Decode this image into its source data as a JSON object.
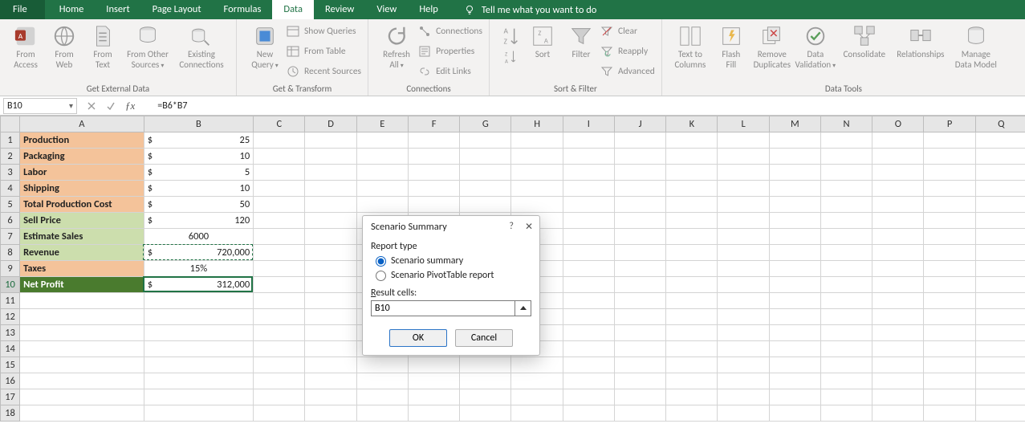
{
  "tabs": {
    "file": "File",
    "home": "Home",
    "insert": "Insert",
    "page_layout": "Page Layout",
    "formulas": "Formulas",
    "data": "Data",
    "review": "Review",
    "view": "View",
    "help": "Help",
    "tell": "Tell me what you want to do"
  },
  "ribbon": {
    "ext_data": {
      "label": "Get External Data",
      "from_access": "From\nAccess",
      "from_web": "From\nWeb",
      "from_text": "From\nText",
      "from_other": "From Other\nSources",
      "existing": "Existing\nConnections"
    },
    "get_transform": {
      "label": "Get & Transform",
      "new_query": "New\nQuery",
      "show_queries": "Show Queries",
      "from_table": "From Table",
      "recent_sources": "Recent Sources"
    },
    "connections": {
      "label": "Connections",
      "refresh_all": "Refresh\nAll",
      "connections": "Connections",
      "properties": "Properties",
      "edit_links": "Edit Links"
    },
    "sort_filter": {
      "label": "Sort & Filter",
      "sort": "Sort",
      "filter": "Filter",
      "clear": "Clear",
      "reapply": "Reapply",
      "advanced": "Advanced"
    },
    "data_tools": {
      "label": "Data Tools",
      "text_to_columns": "Text to\nColumns",
      "flash_fill": "Flash\nFill",
      "remove_dup": "Remove\nDuplicates",
      "data_validation": "Data\nValidation",
      "consolidate": "Consolidate",
      "relationships": "Relationships",
      "manage_model": "Manage\nData Model"
    }
  },
  "formula_bar": {
    "name": "B10",
    "formula": "=B6*B7"
  },
  "columns": [
    "A",
    "B",
    "C",
    "D",
    "E",
    "F",
    "G",
    "H",
    "I",
    "J",
    "K",
    "L",
    "M",
    "N",
    "O",
    "P",
    "Q"
  ],
  "rows": [
    {
      "n": 1,
      "a": "Production",
      "b_cur": "$",
      "b_val": "25",
      "a_cls": "orange"
    },
    {
      "n": 2,
      "a": "Packaging",
      "b_cur": "$",
      "b_val": "10",
      "a_cls": "orange"
    },
    {
      "n": 3,
      "a": "Labor",
      "b_cur": "$",
      "b_val": "5",
      "a_cls": "orange"
    },
    {
      "n": 4,
      "a": "Shipping",
      "b_cur": "$",
      "b_val": "10",
      "a_cls": "orange"
    },
    {
      "n": 5,
      "a": "Total Production Cost",
      "b_cur": "$",
      "b_val": "50",
      "a_cls": "orange"
    },
    {
      "n": 6,
      "a": "Sell Price",
      "b_cur": "$",
      "b_val": "120",
      "a_cls": "ltgreen"
    },
    {
      "n": 7,
      "a": "Estimate Sales",
      "b_center": "6000",
      "a_cls": "ltgreen"
    },
    {
      "n": 8,
      "a": "Revenue",
      "b_cur": "$",
      "b_val": "720,000",
      "a_cls": "ltgreen"
    },
    {
      "n": 9,
      "a": "Taxes",
      "b_center": "15%",
      "a_cls": "orange"
    },
    {
      "n": 10,
      "a": "Net Profit",
      "b_cur": "$",
      "b_val": "312,000",
      "a_cls": "dkgreen"
    },
    {
      "n": 11
    },
    {
      "n": 12
    },
    {
      "n": 13
    },
    {
      "n": 14
    },
    {
      "n": 15
    },
    {
      "n": 16
    },
    {
      "n": 17
    },
    {
      "n": 18
    }
  ],
  "dialog": {
    "title": "Scenario Summary",
    "report_type": "Report type",
    "opt_summary": "Scenario summary",
    "opt_pivot": "Scenario PivotTable report",
    "result_cells": "Result cells:",
    "value": "B10",
    "ok": "OK",
    "cancel": "Cancel"
  }
}
